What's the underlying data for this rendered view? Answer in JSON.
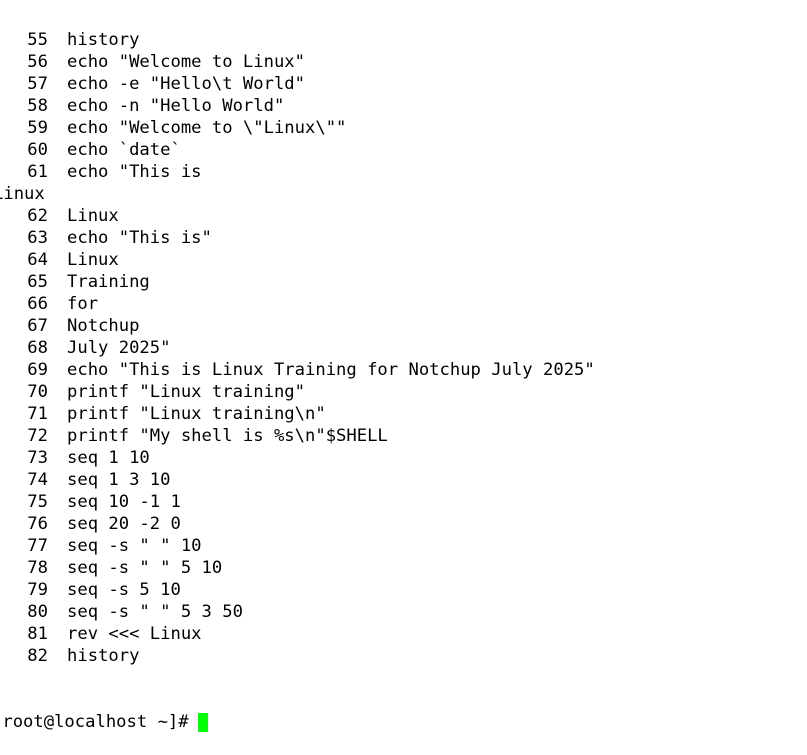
{
  "terminal": {
    "history_lines": [
      {
        "num": "55",
        "cmd": "history"
      },
      {
        "num": "56",
        "cmd": "echo \"Welcome to Linux\""
      },
      {
        "num": "57",
        "cmd": "echo -e \"Hello\\t World\""
      },
      {
        "num": "58",
        "cmd": "echo -n \"Hello World\""
      },
      {
        "num": "59",
        "cmd": "echo \"Welcome to \\\"Linux\\\"\""
      },
      {
        "num": "60",
        "cmd": "echo `date`"
      },
      {
        "num": "61",
        "cmd": "echo \"This is"
      },
      {
        "continuation": "Linux"
      },
      {
        "num": "62",
        "cmd": "Linux"
      },
      {
        "num": "63",
        "cmd": "echo \"This is\""
      },
      {
        "num": "64",
        "cmd": "Linux"
      },
      {
        "num": "65",
        "cmd": "Training"
      },
      {
        "num": "66",
        "cmd": "for"
      },
      {
        "num": "67",
        "cmd": "Notchup"
      },
      {
        "num": "68",
        "cmd": "July 2025\""
      },
      {
        "num": "69",
        "cmd": "echo \"This is Linux Training for Notchup July 2025\""
      },
      {
        "num": "70",
        "cmd": "printf \"Linux training\""
      },
      {
        "num": "71",
        "cmd": "printf \"Linux training\\n\""
      },
      {
        "num": "72",
        "cmd": "printf \"My shell is %s\\n\"$SHELL"
      },
      {
        "num": "73",
        "cmd": "seq 1 10"
      },
      {
        "num": "74",
        "cmd": "seq 1 3 10"
      },
      {
        "num": "75",
        "cmd": "seq 10 -1 1"
      },
      {
        "num": "76",
        "cmd": "seq 20 -2 0"
      },
      {
        "num": "77",
        "cmd": "seq -s \" \" 10"
      },
      {
        "num": "78",
        "cmd": "seq -s \" \" 5 10"
      },
      {
        "num": "79",
        "cmd": "seq -s 5 10"
      },
      {
        "num": "80",
        "cmd": "seq -s \" \" 5 3 50"
      },
      {
        "num": "81",
        "cmd": "rev <<< Linux"
      },
      {
        "num": "82",
        "cmd": "history"
      }
    ],
    "prompt": "[root@localhost ~]#",
    "cursor_color": "#00ff00",
    "background_color": "#ffffff",
    "text_color": "#000000"
  }
}
